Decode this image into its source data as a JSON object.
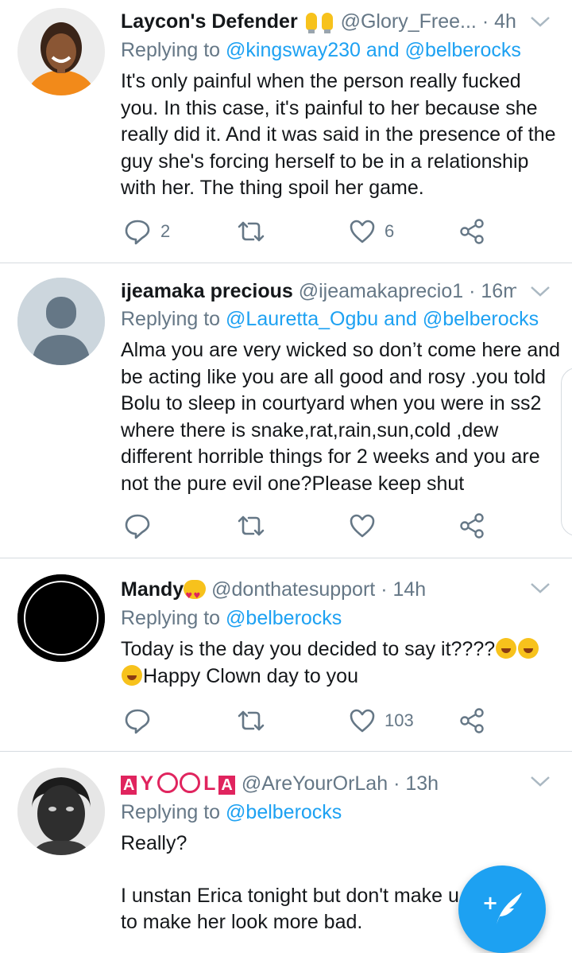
{
  "tweets": [
    {
      "name": "Laycon's Defender",
      "handle": "@Glory_Free...",
      "time": "4h",
      "replying_prefix": "Replying to",
      "replying_to": [
        "@kingsway230",
        "@belberocks"
      ],
      "replying_joiner": "and",
      "text": "It's only painful when the person really fucked you.  In this case, it's painful to her because she really did it. And it was said in the presence of the guy she's forcing herself to be in a relationship with her. The thing spoil her game.",
      "reply_count": "2",
      "like_count": "6"
    },
    {
      "name": "ijeamaka precious",
      "handle": "@ijeamakaprecio1",
      "time": "16m",
      "replying_prefix": "Replying to",
      "replying_to": [
        "@Lauretta_Ogbu",
        "@belberocks"
      ],
      "replying_joiner": "and",
      "text": "Alma you are very wicked so don’t come here and be acting like you are all good and rosy .you told Bolu to sleep in courtyard when you were in ss2 where there is snake,rat,rain,sun,cold ,dew different horrible things for 2 weeks and you are not the pure evil one?Please keep shut",
      "reply_count": "",
      "like_count": ""
    },
    {
      "name": "Mandy",
      "handle": "@donthatesupport",
      "time": "14h",
      "replying_prefix": "Replying to",
      "replying_to": [
        "@belberocks"
      ],
      "text_line1": "Today is the day you decided to say it????",
      "text_line2": "Happy Clown day to you",
      "reply_count": "",
      "like_count": "103"
    },
    {
      "name_parts": [
        "A",
        "Y",
        "L",
        "A"
      ],
      "handle": "@AreYourOrLah",
      "time": "13h",
      "replying_prefix": "Replying to",
      "replying_to": [
        "@belberocks"
      ],
      "text_line1": "Really?",
      "text_line2": "I unstan Erica tonight but don't make u",
      "text_line3": "to make her look more bad."
    }
  ],
  "separator": "·",
  "icons": {
    "reply": "reply-icon",
    "retweet": "retweet-icon",
    "like": "heart-icon",
    "share": "share-icon",
    "menu": "chevron-down-icon",
    "compose": "compose-tweet-icon"
  },
  "colors": {
    "link": "#1da1f2",
    "secondary_text": "#657786",
    "fab": "#1da1f2"
  }
}
